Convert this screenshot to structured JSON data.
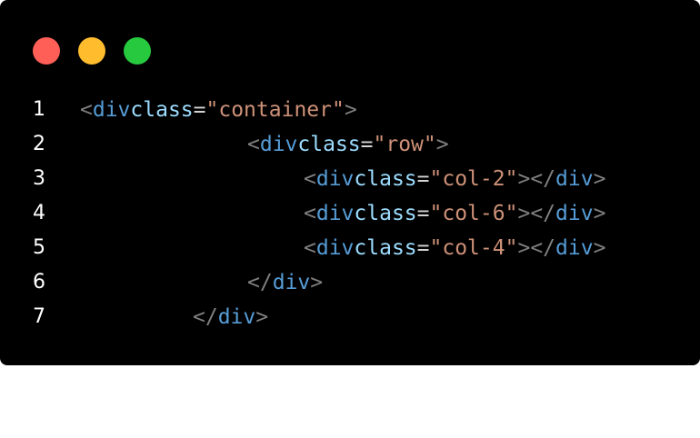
{
  "window": {
    "controls": [
      {
        "name": "close",
        "color": "#ff5f56"
      },
      {
        "name": "minimize",
        "color": "#ffbd2e"
      },
      {
        "name": "maximize",
        "color": "#27c93f"
      }
    ]
  },
  "code": {
    "lines": [
      {
        "number": "1",
        "open": "<",
        "tag": "div",
        "attr": "class",
        "eq": "=",
        "value": "\"container\"",
        "close": ">"
      },
      {
        "number": "2",
        "open": "<",
        "tag": "div",
        "attr": "class",
        "eq": "=",
        "value": "\"row\"",
        "close": ">"
      },
      {
        "number": "3",
        "open": "<",
        "tag": "div",
        "attr": "class",
        "eq": "=",
        "value": "\"col-2\"",
        "close": ">",
        "end_open": "</",
        "end_tag": "div",
        "end_close": ">"
      },
      {
        "number": "4",
        "open": "<",
        "tag": "div",
        "attr": "class",
        "eq": "=",
        "value": "\"col-6\"",
        "close": ">",
        "end_open": "</",
        "end_tag": "div",
        "end_close": ">"
      },
      {
        "number": "5",
        "open": "<",
        "tag": "div",
        "attr": "class",
        "eq": "=",
        "value": "\"col-4\"",
        "close": ">",
        "end_open": "</",
        "end_tag": "div",
        "end_close": ">"
      },
      {
        "number": "6",
        "end_open": "</",
        "end_tag": "div",
        "end_close": ">"
      },
      {
        "number": "7",
        "end_open": "</",
        "end_tag": "div",
        "end_close": ">"
      }
    ]
  }
}
